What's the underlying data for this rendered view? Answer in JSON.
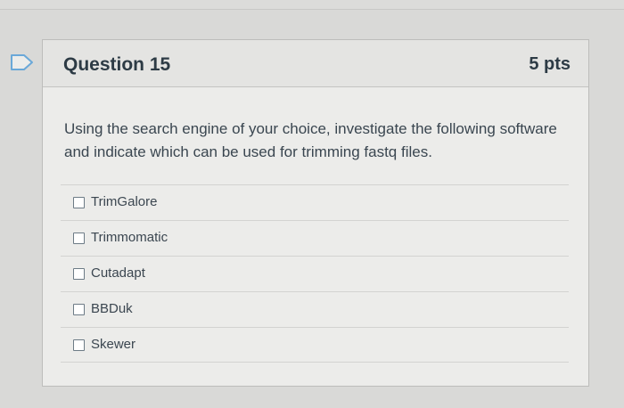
{
  "question": {
    "title": "Question 15",
    "points": "5 pts",
    "text": "Using the search engine of your choice, investigate the following software and indicate which can be used for trimming fastq files.",
    "flag_icon": "flag-icon"
  },
  "answers": [
    {
      "label": "TrimGalore",
      "checked": false
    },
    {
      "label": "Trimmomatic",
      "checked": false
    },
    {
      "label": "Cutadapt",
      "checked": false
    },
    {
      "label": "BBDuk",
      "checked": false
    },
    {
      "label": "Skewer",
      "checked": false
    }
  ],
  "colors": {
    "page_bg": "#d9d9d7",
    "card_bg": "#ececea",
    "header_bg": "#e4e4e2",
    "text": "#2d3b45",
    "flag_outline": "#6aa8d8"
  }
}
